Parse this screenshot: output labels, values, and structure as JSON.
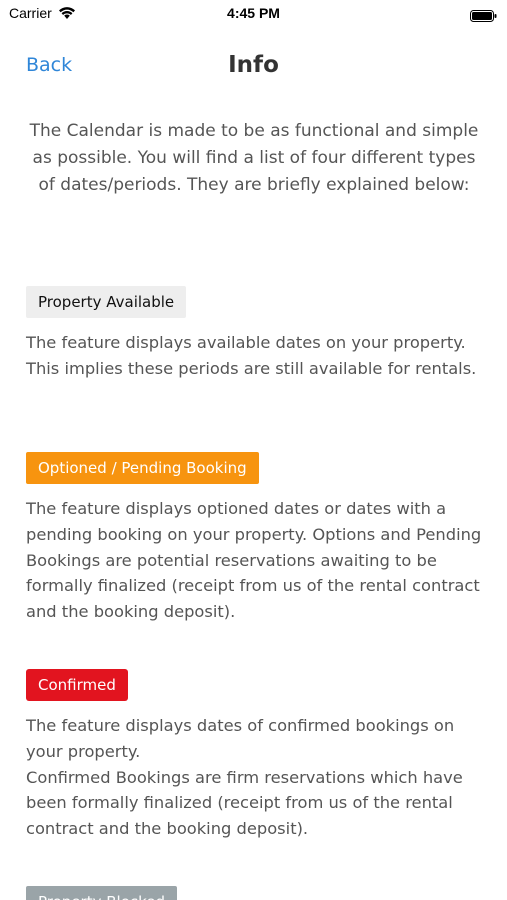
{
  "status_bar": {
    "carrier": "Carrier",
    "time": "4:45 PM",
    "icons": [
      "wifi-icon",
      "battery-icon"
    ]
  },
  "nav": {
    "back_label": "Back",
    "title": "Info",
    "back_color": "#2f86d8"
  },
  "intro": "The Calendar is made to be as functional and simple as possible. You will find a list of four different types of dates/periods. They are briefly explained below:",
  "sections": [
    {
      "label": "Property Available",
      "color": "#eeeeee",
      "description": [
        "The feature displays available dates on your property. This implies these periods are still available for rentals."
      ]
    },
    {
      "label": "Optioned / Pending Booking",
      "color": "#f7940f",
      "description": [
        "The feature displays optioned dates or dates with a pending booking on your property. Options and Pending Bookings are potential reservations awaiting to be formally finalized (receipt from us of the rental contract and the booking deposit)."
      ]
    },
    {
      "label": "Confirmed",
      "color": "#e2141f",
      "description": [
        "The feature displays dates of confirmed bookings on your property.",
        "Confirmed Bookings are firm reservations which have been formally finalized (receipt from us of the rental contract and the booking deposit)."
      ]
    },
    {
      "label": "Property Blocked",
      "color": "#9aa4a8",
      "description": []
    }
  ]
}
